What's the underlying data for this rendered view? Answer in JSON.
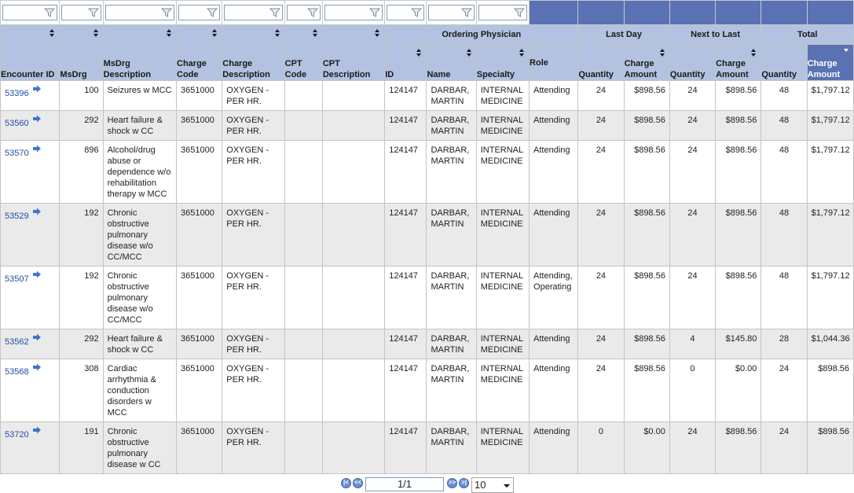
{
  "filters": [
    "",
    "",
    "",
    "",
    "",
    "",
    "",
    "",
    "",
    "",
    ""
  ],
  "group_headers": {
    "ordering_physician": "Ordering Physician",
    "last_day": "Last Day",
    "next_to_last": "Next to Last",
    "total": "Total"
  },
  "columns": {
    "encounter_id": "Encounter ID",
    "msdrg": "MsDrg",
    "msdrg_desc": "MsDrg Description",
    "charge_code": "Charge Code",
    "charge_desc": "Charge Description",
    "cpt_code": "CPT Code",
    "cpt_desc": "CPT Description",
    "phys_id": "ID",
    "phys_name": "Name",
    "phys_specialty": "Specialty",
    "phys_role": "Role",
    "ld_qty": "Quantity",
    "ld_amt": "Charge Amount",
    "ntl_qty": "Quantity",
    "ntl_amt": "Charge Amount",
    "tot_qty": "Quantity",
    "tot_amt": "Charge Amount"
  },
  "rows": [
    {
      "encounter_id": "53396",
      "msdrg": "100",
      "msdrg_desc": "Seizures w MCC",
      "charge_code": "3651000",
      "charge_desc": "OXYGEN - PER HR.",
      "cpt_code": "",
      "cpt_desc": "",
      "phys_id": "124147",
      "phys_name": "DARBAR, MARTIN",
      "phys_specialty": "INTERNAL MEDICINE",
      "phys_role": "Attending",
      "ld_qty": "24",
      "ld_amt": "$898.56",
      "ntl_qty": "24",
      "ntl_amt": "$898.56",
      "tot_qty": "48",
      "tot_amt": "$1,797.12"
    },
    {
      "encounter_id": "53560",
      "msdrg": "292",
      "msdrg_desc": "Heart failure & shock w CC",
      "charge_code": "3651000",
      "charge_desc": "OXYGEN - PER HR.",
      "cpt_code": "",
      "cpt_desc": "",
      "phys_id": "124147",
      "phys_name": "DARBAR, MARTIN",
      "phys_specialty": "INTERNAL MEDICINE",
      "phys_role": "Attending",
      "ld_qty": "24",
      "ld_amt": "$898.56",
      "ntl_qty": "24",
      "ntl_amt": "$898.56",
      "tot_qty": "48",
      "tot_amt": "$1,797.12"
    },
    {
      "encounter_id": "53570",
      "msdrg": "896",
      "msdrg_desc": "Alcohol/drug abuse or dependence w/o rehabilitation therapy w MCC",
      "charge_code": "3651000",
      "charge_desc": "OXYGEN - PER HR.",
      "cpt_code": "",
      "cpt_desc": "",
      "phys_id": "124147",
      "phys_name": "DARBAR, MARTIN",
      "phys_specialty": "INTERNAL MEDICINE",
      "phys_role": "Attending",
      "ld_qty": "24",
      "ld_amt": "$898.56",
      "ntl_qty": "24",
      "ntl_amt": "$898.56",
      "tot_qty": "48",
      "tot_amt": "$1,797.12"
    },
    {
      "encounter_id": "53529",
      "msdrg": "192",
      "msdrg_desc": "Chronic obstructive pulmonary disease w/o CC/MCC",
      "charge_code": "3651000",
      "charge_desc": "OXYGEN - PER HR.",
      "cpt_code": "",
      "cpt_desc": "",
      "phys_id": "124147",
      "phys_name": "DARBAR, MARTIN",
      "phys_specialty": "INTERNAL MEDICINE",
      "phys_role": "Attending",
      "ld_qty": "24",
      "ld_amt": "$898.56",
      "ntl_qty": "24",
      "ntl_amt": "$898.56",
      "tot_qty": "48",
      "tot_amt": "$1,797.12"
    },
    {
      "encounter_id": "53507",
      "msdrg": "192",
      "msdrg_desc": "Chronic obstructive pulmonary disease w/o CC/MCC",
      "charge_code": "3651000",
      "charge_desc": "OXYGEN - PER HR.",
      "cpt_code": "",
      "cpt_desc": "",
      "phys_id": "124147",
      "phys_name": "DARBAR, MARTIN",
      "phys_specialty": "INTERNAL MEDICINE",
      "phys_role": "Attending, Operating",
      "ld_qty": "24",
      "ld_amt": "$898.56",
      "ntl_qty": "24",
      "ntl_amt": "$898.56",
      "tot_qty": "48",
      "tot_amt": "$1,797.12"
    },
    {
      "encounter_id": "53562",
      "msdrg": "292",
      "msdrg_desc": "Heart failure & shock w CC",
      "charge_code": "3651000",
      "charge_desc": "OXYGEN - PER HR.",
      "cpt_code": "",
      "cpt_desc": "",
      "phys_id": "124147",
      "phys_name": "DARBAR, MARTIN",
      "phys_specialty": "INTERNAL MEDICINE",
      "phys_role": "Attending",
      "ld_qty": "24",
      "ld_amt": "$898.56",
      "ntl_qty": "4",
      "ntl_amt": "$145.80",
      "tot_qty": "28",
      "tot_amt": "$1,044.36"
    },
    {
      "encounter_id": "53568",
      "msdrg": "308",
      "msdrg_desc": "Cardiac arrhythmia & conduction disorders w MCC",
      "charge_code": "3651000",
      "charge_desc": "OXYGEN - PER HR.",
      "cpt_code": "",
      "cpt_desc": "",
      "phys_id": "124147",
      "phys_name": "DARBAR, MARTIN",
      "phys_specialty": "INTERNAL MEDICINE",
      "phys_role": "Attending",
      "ld_qty": "24",
      "ld_amt": "$898.56",
      "ntl_qty": "0",
      "ntl_amt": "$0.00",
      "tot_qty": "24",
      "tot_amt": "$898.56"
    },
    {
      "encounter_id": "53720",
      "msdrg": "191",
      "msdrg_desc": "Chronic obstructive pulmonary disease w CC",
      "charge_code": "3651000",
      "charge_desc": "OXYGEN - PER HR.",
      "cpt_code": "",
      "cpt_desc": "",
      "phys_id": "124147",
      "phys_name": "DARBAR, MARTIN",
      "phys_specialty": "INTERNAL MEDICINE",
      "phys_role": "Attending",
      "ld_qty": "0",
      "ld_amt": "$0.00",
      "ntl_qty": "24",
      "ntl_amt": "$898.56",
      "tot_qty": "24",
      "tot_amt": "$898.56"
    }
  ],
  "pager": {
    "page_indicator": "1/1",
    "page_size": "10",
    "first_icon": "first-page-icon",
    "prev_icon": "prev-page-icon",
    "next_icon": "next-page-icon",
    "last_icon": "last-page-icon"
  },
  "colors": {
    "header_bg": "#b2c2e0",
    "sorted_header_bg": "#5a72b3",
    "link": "#1f4ea3",
    "alt_row": "#eaeaea"
  }
}
